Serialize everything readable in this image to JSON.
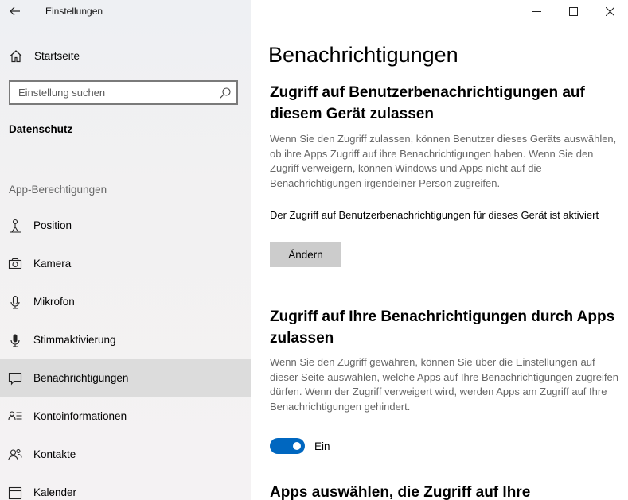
{
  "window": {
    "title": "Einstellungen"
  },
  "sidebar": {
    "home_label": "Startseite",
    "search": {
      "placeholder": "Einstellung suchen"
    },
    "section_heading": "Datenschutz",
    "group_label": "App-Berechtigungen",
    "items": [
      {
        "label": "Position",
        "icon": "person-location-icon",
        "selected": false
      },
      {
        "label": "Kamera",
        "icon": "camera-icon",
        "selected": false
      },
      {
        "label": "Mikrofon",
        "icon": "microphone-icon",
        "selected": false
      },
      {
        "label": "Stimmaktivierung",
        "icon": "voice-activation-icon",
        "selected": false
      },
      {
        "label": "Benachrichtigungen",
        "icon": "notification-icon",
        "selected": true
      },
      {
        "label": "Kontoinformationen",
        "icon": "account-info-icon",
        "selected": false
      },
      {
        "label": "Kontakte",
        "icon": "contacts-icon",
        "selected": false
      },
      {
        "label": "Kalender",
        "icon": "calendar-icon",
        "selected": false
      }
    ]
  },
  "main": {
    "title": "Benachrichtigungen",
    "section1": {
      "heading": "Zugriff auf Benutzerbenachrichtigungen auf diesem Gerät zulassen",
      "description": "Wenn Sie den Zugriff zulassen, können Benutzer dieses Geräts auswählen, ob ihre Apps Zugriff auf ihre Benachrichtigungen haben. Wenn Sie den Zugriff verweigern, können Windows und Apps nicht auf die Benachrichtigungen irgendeiner Person zugreifen.",
      "status": "Der Zugriff auf Benutzerbenachrichtigungen für dieses Gerät ist aktiviert",
      "button_label": "Ändern"
    },
    "section2": {
      "heading": "Zugriff auf Ihre Benachrichtigungen durch Apps zulassen",
      "description": "Wenn Sie den Zugriff gewähren, können Sie über die Einstellungen auf dieser Seite auswählen, welche Apps auf Ihre Benachrichtigungen zugreifen dürfen. Wenn der Zugriff verweigert wird, werden Apps am Zugriff auf Ihre Benachrichtigungen gehindert.",
      "toggle_state": "Ein"
    },
    "section3": {
      "heading": "Apps auswählen, die Zugriff auf Ihre"
    }
  },
  "colors": {
    "accent": "#0067c0",
    "selected_bg": "#dcdcdc",
    "button_bg": "#cccccc"
  }
}
